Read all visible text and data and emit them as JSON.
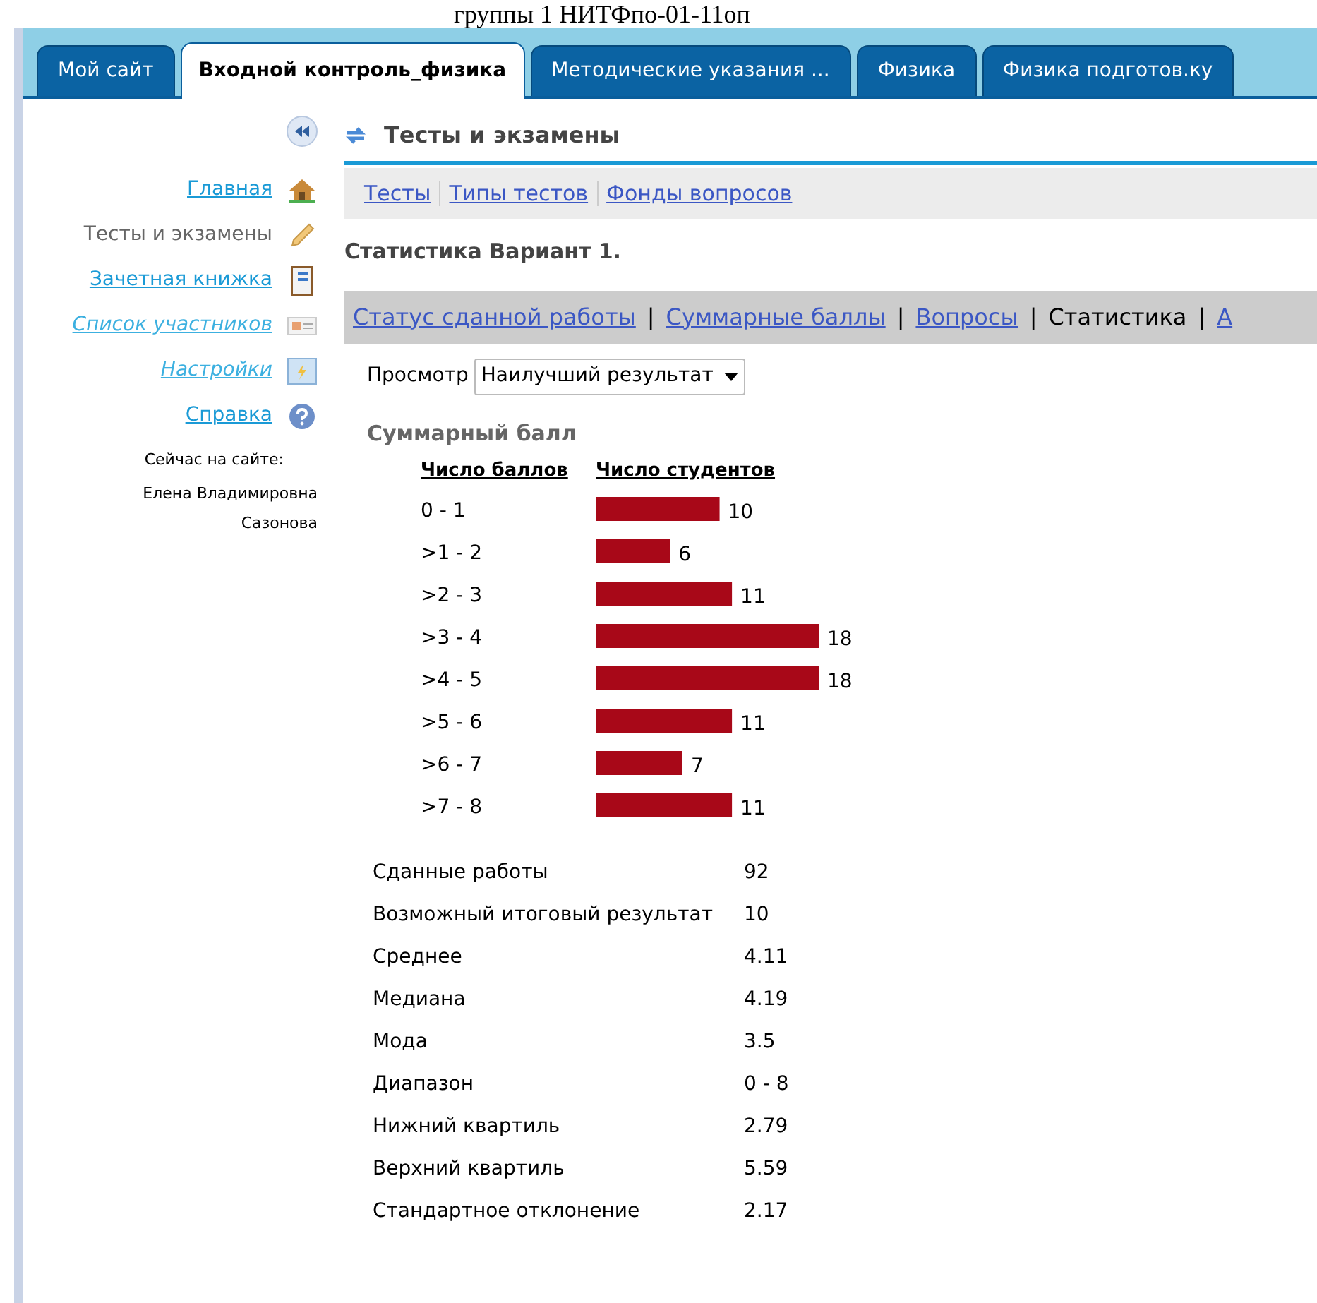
{
  "header_text": "группы 1 НИТФпо-01-11оп",
  "tabs": [
    {
      "label": "Мой сайт",
      "selected": false
    },
    {
      "label": "Входной контроль_физика",
      "selected": true
    },
    {
      "label": "Методические указания ...",
      "selected": false
    },
    {
      "label": "Физика",
      "selected": false
    },
    {
      "label": "Физика подготов.ку",
      "selected": false
    }
  ],
  "sidebar": {
    "items": [
      {
        "label": "Главная",
        "kind": "home",
        "selected": false,
        "italic": false
      },
      {
        "label": "Тесты и экзамены",
        "kind": "pencil",
        "selected": true,
        "italic": false
      },
      {
        "label": "Зачетная книжка",
        "kind": "notebook",
        "selected": false,
        "italic": false
      },
      {
        "label": "Список участников",
        "kind": "card",
        "selected": false,
        "italic": true
      },
      {
        "label": "Настройки",
        "kind": "settings",
        "selected": false,
        "italic": true
      },
      {
        "label": "Справка",
        "kind": "help",
        "selected": false,
        "italic": false
      }
    ],
    "online_label": "Сейчас на сайте:",
    "online_user": "Елена Владимировна Сазонова"
  },
  "section_title": "Тесты и экзамены",
  "section_links": [
    {
      "label": "Тесты"
    },
    {
      "label": "Типы тестов"
    },
    {
      "label": "Фонды вопросов"
    }
  ],
  "page_title": "Статистика Вариант 1.",
  "subnav_separator": "|",
  "subnav": [
    {
      "label": "Статус сданной работы",
      "selected": false
    },
    {
      "label": "Суммарные баллы",
      "selected": false
    },
    {
      "label": "Вопросы",
      "selected": false
    },
    {
      "label": "Статистика",
      "selected": true
    },
    {
      "label": "А",
      "selected": false
    }
  ],
  "view": {
    "label": "Просмотр",
    "value": "Наилучший результат"
  },
  "distribution": {
    "title": "Суммарный балл",
    "column_1": "Число баллов",
    "chart_data": {
      "type": "bar",
      "orientation": "horizontal",
      "data_labels": true,
      "categories": [
        "0 - 1",
        ">1 - 2",
        ">2 - 3",
        ">3 - 4",
        ">4 - 5",
        ">5 - 6",
        ">6 - 7",
        ">7 - 8"
      ],
      "series": [
        {
          "name": "Число студентов",
          "color": "#a80818",
          "values": [
            10,
            6,
            11,
            18,
            18,
            11,
            7,
            11
          ]
        }
      ]
    }
  },
  "stats": [
    {
      "label": "Сданные работы",
      "value": "92"
    },
    {
      "label": "Возможный итоговый результат",
      "value": "10"
    },
    {
      "label": "Среднее",
      "value": "4.11"
    },
    {
      "label": "Медиана",
      "value": "4.19"
    },
    {
      "label": "Мода",
      "value": "3.5"
    },
    {
      "label": "Диапазон",
      "value": "0 - 8"
    },
    {
      "label": "Нижний квартиль",
      "value": "2.79"
    },
    {
      "label": "Верхний квартиль",
      "value": "5.59"
    },
    {
      "label": "Стандартное отклонение",
      "value": "2.17"
    }
  ]
}
